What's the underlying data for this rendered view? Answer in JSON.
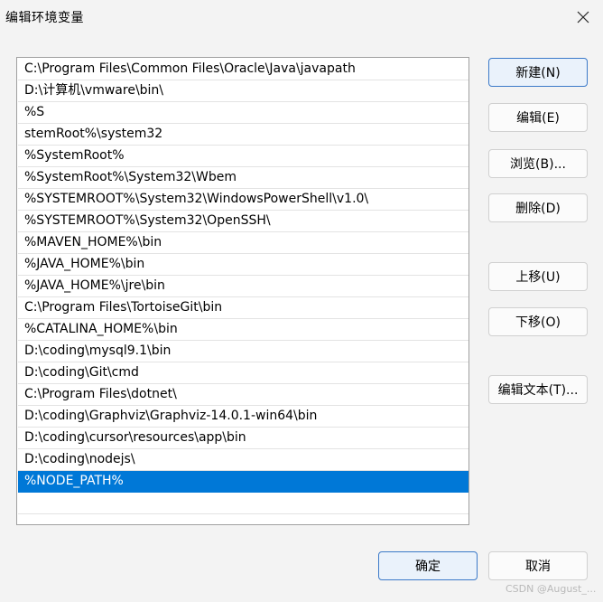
{
  "window": {
    "title": "编辑环境变量"
  },
  "icons": {
    "close": "close-icon"
  },
  "paths": [
    "C:\\Program Files\\Common Files\\Oracle\\Java\\javapath",
    "D:\\计算机\\vmware\\bin\\",
    "%S",
    "stemRoot%\\system32",
    "%SystemRoot%",
    "%SystemRoot%\\System32\\Wbem",
    "%SYSTEMROOT%\\System32\\WindowsPowerShell\\v1.0\\",
    "%SYSTEMROOT%\\System32\\OpenSSH\\",
    "%MAVEN_HOME%\\bin",
    "%JAVA_HOME%\\bin",
    "%JAVA_HOME%\\jre\\bin",
    "C:\\Program Files\\TortoiseGit\\bin",
    "%CATALINA_HOME%\\bin",
    "D:\\coding\\mysql9.1\\bin",
    "D:\\coding\\Git\\cmd",
    "C:\\Program Files\\dotnet\\",
    "D:\\coding\\Graphviz\\Graphviz-14.0.1-win64\\bin",
    "D:\\coding\\cursor\\resources\\app\\bin",
    "D:\\coding\\nodejs\\",
    "%NODE_PATH%",
    ""
  ],
  "selected_index": 19,
  "buttons": {
    "new": "新建(N)",
    "edit": "编辑(E)",
    "browse": "浏览(B)...",
    "delete": "删除(D)",
    "move_up": "上移(U)",
    "move_down": "下移(O)",
    "edit_text": "编辑文本(T)...",
    "ok": "确定",
    "cancel": "取消"
  },
  "watermark": "CSDN @August_..."
}
